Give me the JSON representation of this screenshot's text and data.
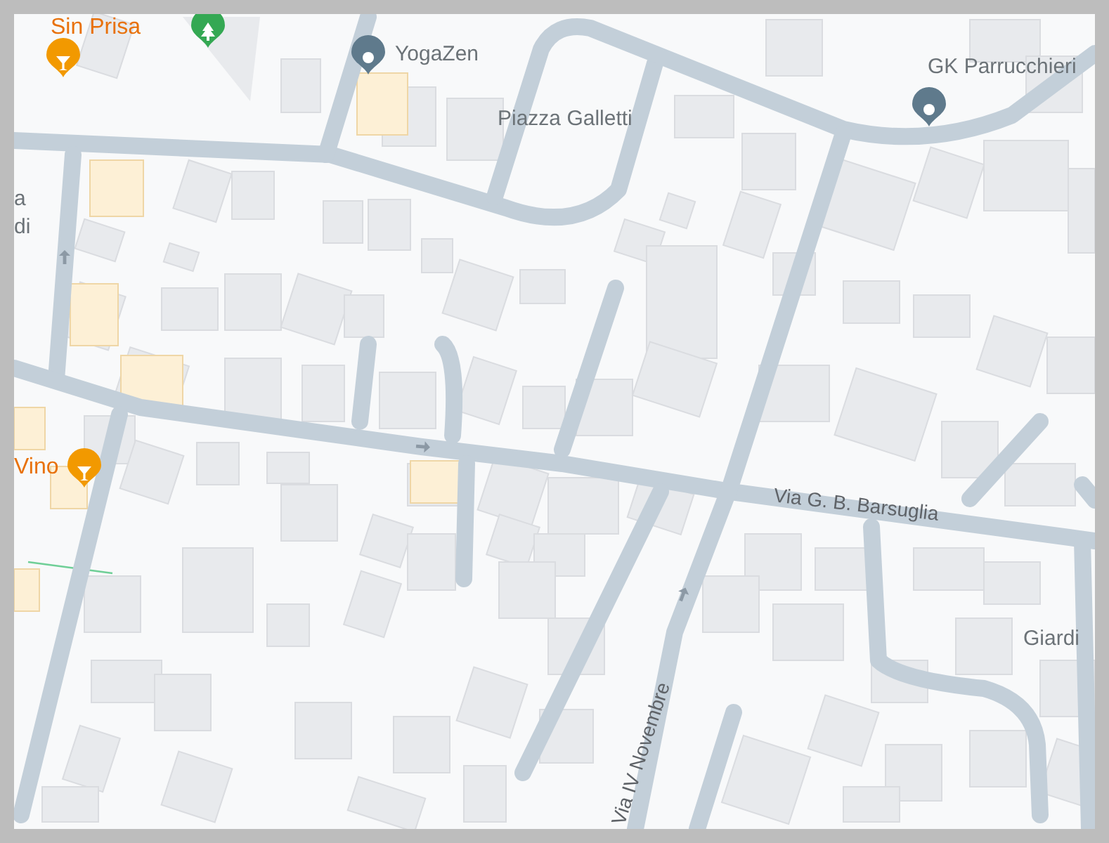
{
  "map": {
    "labels": [
      {
        "kind": "bar",
        "text": "Sin Prisa"
      },
      {
        "kind": "place",
        "text": "YogaZen"
      },
      {
        "kind": "place",
        "text": "Piazza Galletti"
      },
      {
        "kind": "place",
        "text": "GK Parrucchieri"
      },
      {
        "kind": "place",
        "text": "a"
      },
      {
        "kind": "place",
        "text": "di"
      },
      {
        "kind": "bar",
        "text": "Vino"
      },
      {
        "kind": "street",
        "text": "Via G. B. Barsuglia"
      },
      {
        "kind": "street",
        "text": "Via IV Novembre"
      },
      {
        "kind": "place",
        "text": "Giardi"
      }
    ],
    "pins": [
      {
        "kind": "bar"
      },
      {
        "kind": "park"
      },
      {
        "kind": "place"
      },
      {
        "kind": "place"
      },
      {
        "kind": "bar"
      }
    ]
  }
}
